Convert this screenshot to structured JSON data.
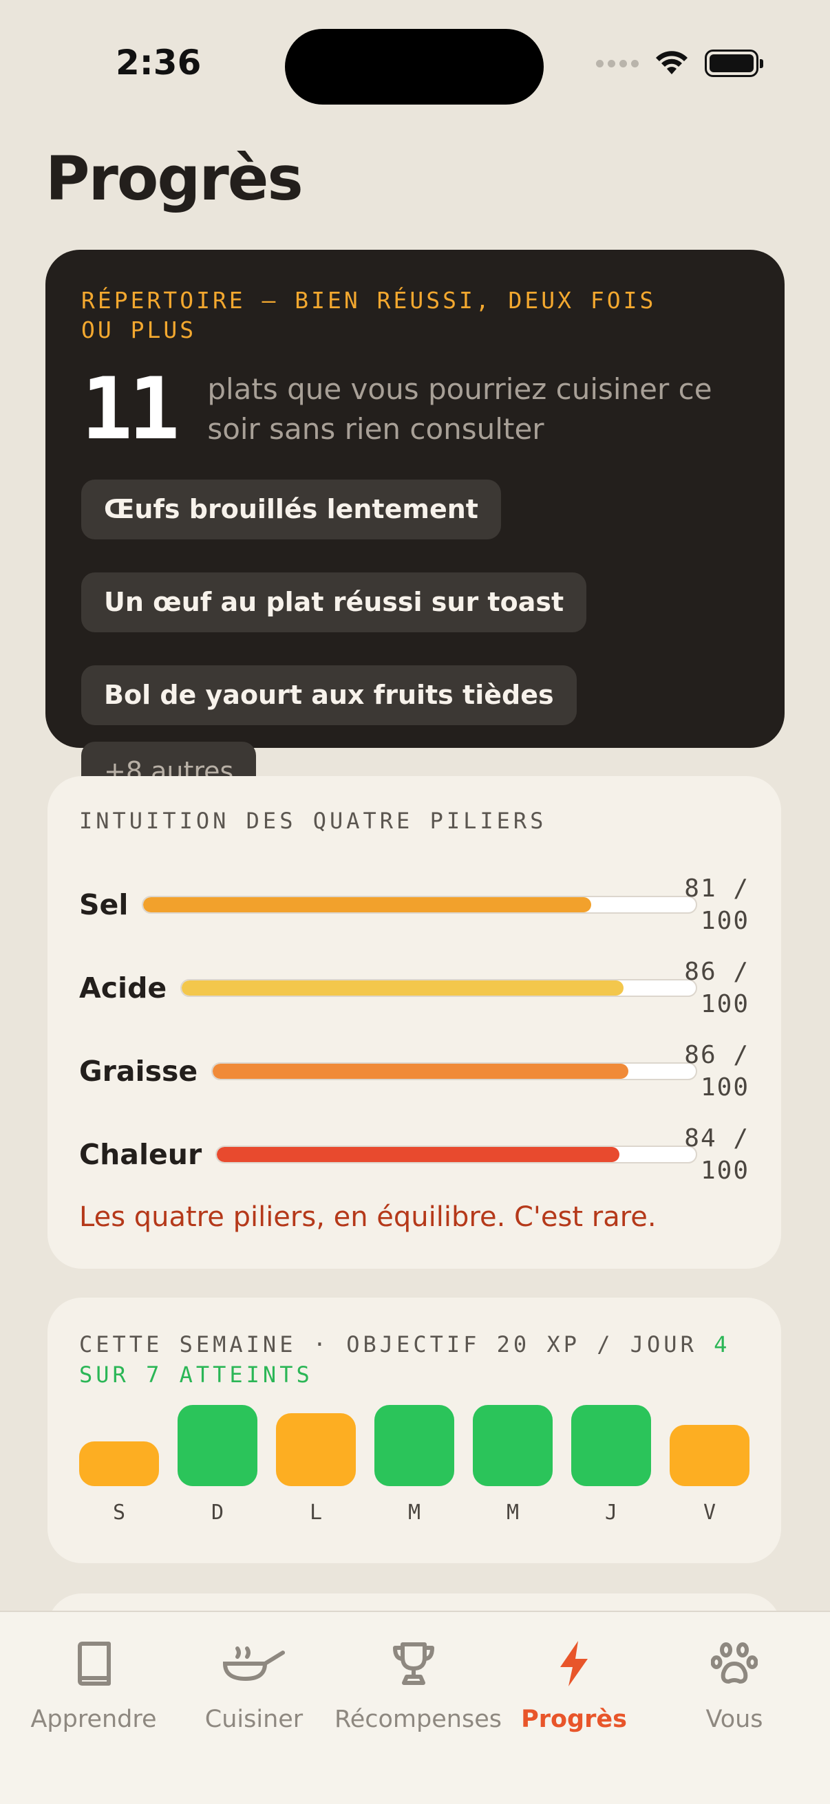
{
  "status": {
    "time": "2:36"
  },
  "page": {
    "title": "Progrès"
  },
  "repertoire": {
    "label": "RÉPERTOIRE — BIEN RÉUSSI, DEUX FOIS OU PLUS",
    "count": "11",
    "description": "plats que vous pourriez cuisiner ce soir sans rien consulter",
    "dishes": [
      "Œufs brouillés lentement",
      "Un œuf au plat réussi sur toast",
      "Bol de yaourt aux fruits tièdes"
    ],
    "more": "+8 autres"
  },
  "pillars": {
    "label": "INTUITION DES QUATRE PILIERS",
    "items": [
      {
        "name": "Sel",
        "score": "81 / 100",
        "value": 0.81,
        "color": "#F2A12C"
      },
      {
        "name": "Acide",
        "score": "86 / 100",
        "value": 0.86,
        "color": "#F3C74C"
      },
      {
        "name": "Graisse",
        "score": "86 / 100",
        "value": 0.86,
        "color": "#F08A38"
      },
      {
        "name": "Chaleur",
        "score": "84 / 100",
        "value": 0.84,
        "color": "#E84A2E"
      }
    ],
    "note": "Les quatre piliers, en équilibre. C'est rare."
  },
  "week": {
    "label": "CETTE SEMAINE · OBJECTIF 20 XP / JOUR",
    "achieved": "4 SUR 7 ATTEINTS",
    "days": [
      {
        "letter": "S",
        "level": 0.55,
        "goal_met": false
      },
      {
        "letter": "D",
        "level": 1.0,
        "goal_met": true
      },
      {
        "letter": "L",
        "level": 0.9,
        "goal_met": false
      },
      {
        "letter": "M",
        "level": 1.0,
        "goal_met": true
      },
      {
        "letter": "M",
        "level": 1.0,
        "goal_met": true
      },
      {
        "letter": "J",
        "level": 1.0,
        "goal_met": true
      },
      {
        "letter": "V",
        "level": 0.75,
        "goal_met": false
      }
    ],
    "colors": {
      "met": "#2BC45A",
      "not_met": "#FDAE22"
    }
  },
  "tabbar": {
    "tabs": [
      {
        "label": "Apprendre",
        "icon": "book-icon",
        "active": false
      },
      {
        "label": "Cuisiner",
        "icon": "pan-icon",
        "active": false
      },
      {
        "label": "Récompenses",
        "icon": "trophy-icon",
        "active": false
      },
      {
        "label": "Progrès",
        "icon": "bolt-icon",
        "active": true
      },
      {
        "label": "Vous",
        "icon": "paw-icon",
        "active": false
      }
    ],
    "colors": {
      "active": "#E8552A",
      "inactive": "#8E8880"
    }
  }
}
